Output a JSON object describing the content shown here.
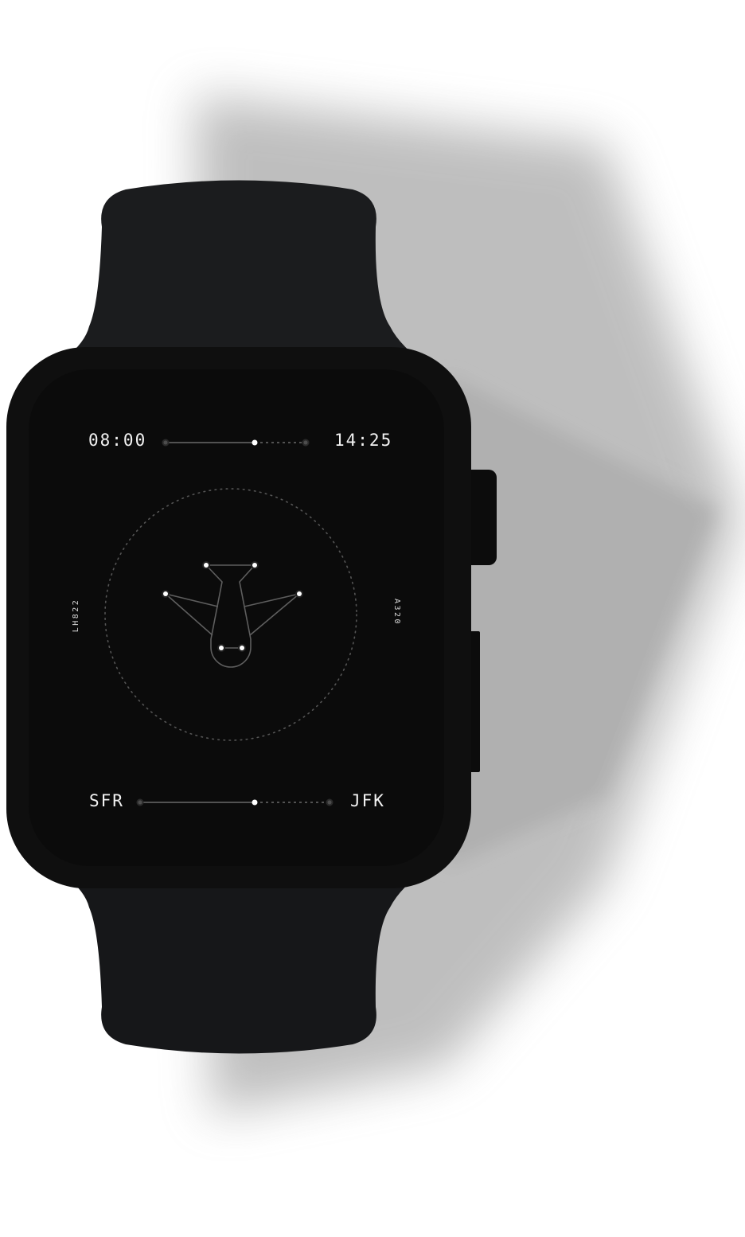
{
  "watch_face": {
    "departure_time": "08:00",
    "arrival_time": "14:25",
    "origin": "SFR",
    "destination": "JFK",
    "flight_number": "LH822",
    "aircraft": "A320",
    "flight_progress": 0.63,
    "airplane_icon": "airplane-icon"
  },
  "colors": {
    "strap": "#1b1c1e",
    "case": "#0f0f0f",
    "screen": "#0b0b0b",
    "text": "#f2f2f2",
    "line": "#5a5a5a",
    "dot_active": "#ffffff",
    "dot_inactive": "#555555"
  }
}
